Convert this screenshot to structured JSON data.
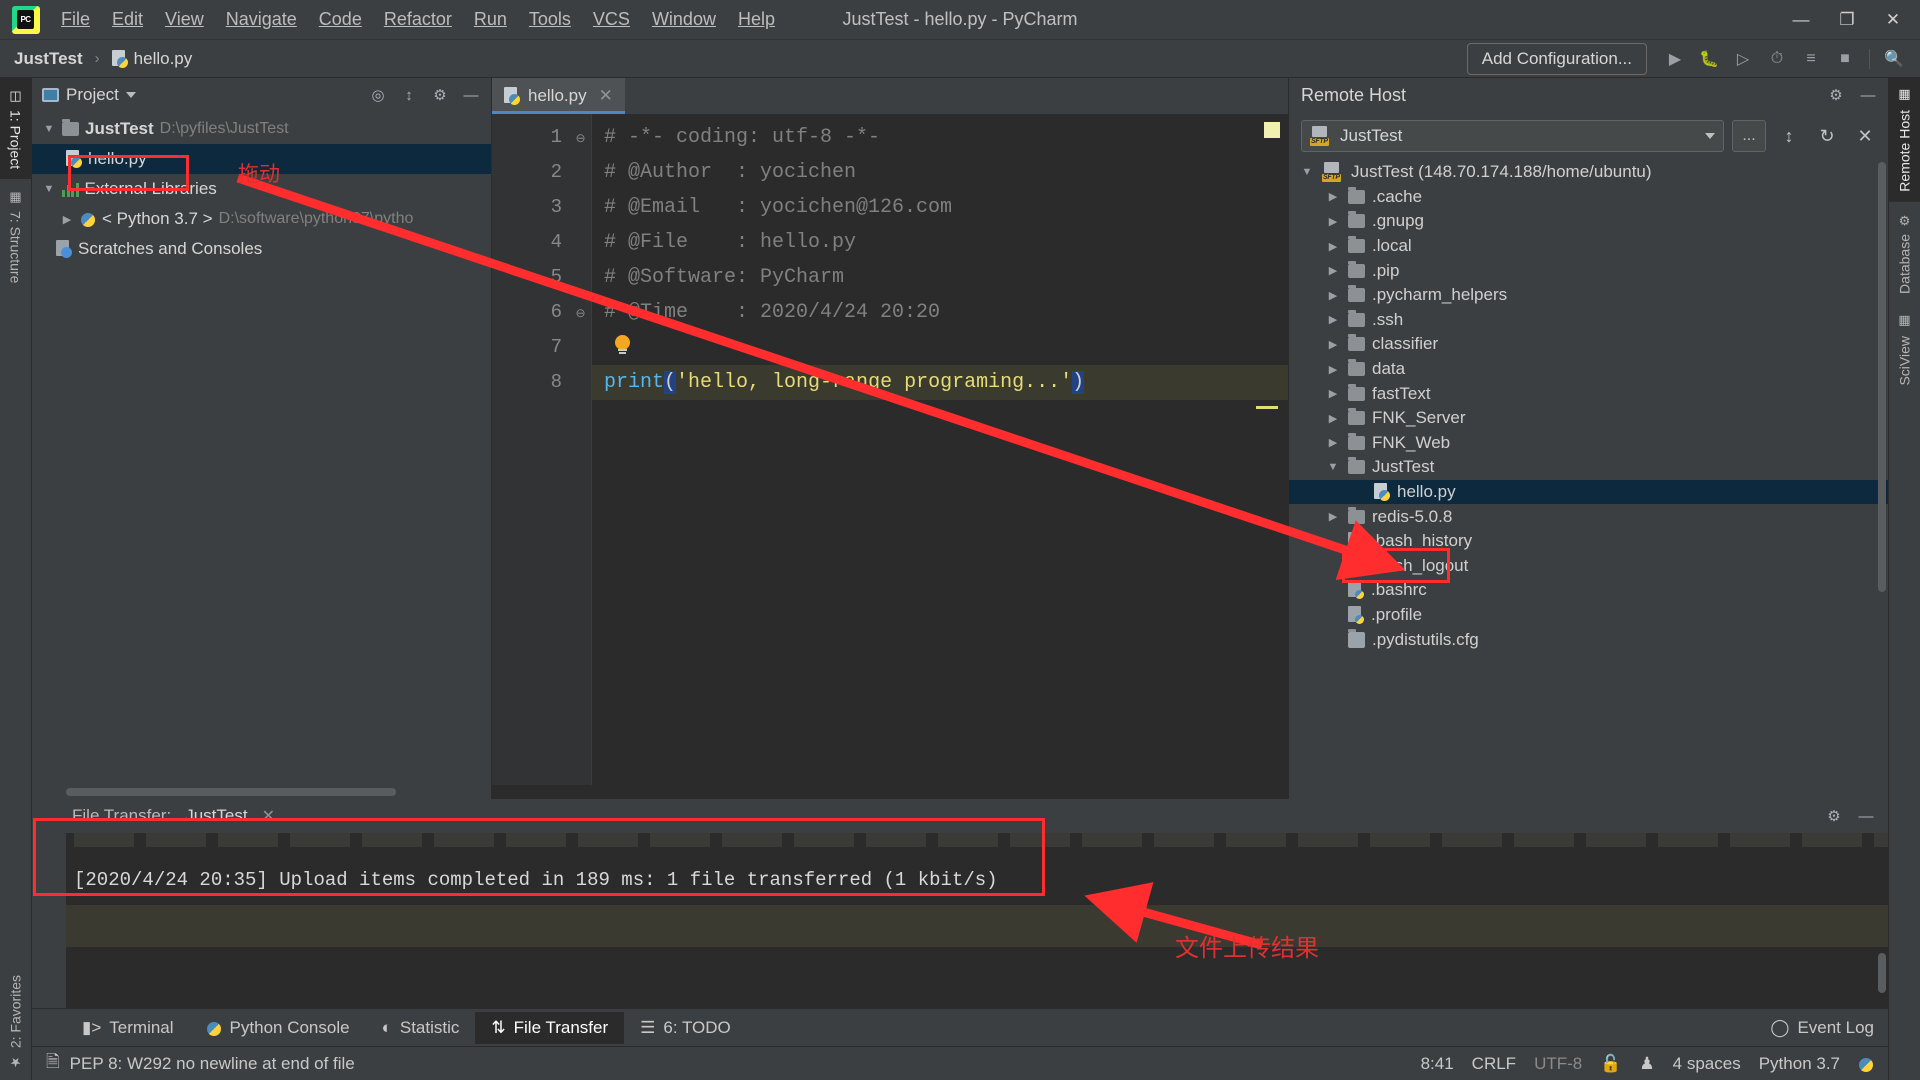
{
  "window": {
    "title": "JustTest - hello.py - PyCharm",
    "logo_label": "PC",
    "minimize": "—",
    "maximize": "❐",
    "close": "✕"
  },
  "menu": [
    {
      "label": "File"
    },
    {
      "label": "Edit"
    },
    {
      "label": "View"
    },
    {
      "label": "Navigate"
    },
    {
      "label": "Code"
    },
    {
      "label": "Refactor"
    },
    {
      "label": "Run"
    },
    {
      "label": "Tools"
    },
    {
      "label": "VCS"
    },
    {
      "label": "Window"
    },
    {
      "label": "Help"
    }
  ],
  "navbar": {
    "breadcrumb_project": "JustTest",
    "breadcrumb_sep": "›",
    "breadcrumb_file": "hello.py",
    "add_configuration": "Add Configuration...",
    "icons": [
      "run-icon",
      "debug-icon",
      "run-coverage-icon",
      "profile-icon",
      "run-with-console-icon",
      "stop-icon",
      "search-everywhere-icon"
    ]
  },
  "left_rail": [
    {
      "label": "1: Project",
      "selected": true,
      "icon": "project-icon"
    },
    {
      "label": "7: Structure",
      "selected": false,
      "icon": "structure-icon"
    },
    {
      "label": "2: Favorites",
      "selected": false,
      "icon": "star-icon"
    }
  ],
  "right_rail": [
    {
      "label": "Remote Host",
      "selected": true,
      "icon": "remote-host-icon"
    },
    {
      "label": "Database",
      "selected": false,
      "icon": "database-icon"
    },
    {
      "label": "SciView",
      "selected": false,
      "icon": "sciview-icon"
    }
  ],
  "project_panel": {
    "title": "Project",
    "head_icons": [
      "locate-icon",
      "collapse-all-icon",
      "gear-icon",
      "hide-icon"
    ],
    "tree": [
      {
        "arrow": "▼",
        "icon": "folder-icon",
        "label": "JustTest",
        "suffix": "D:\\pyfiles\\JustTest",
        "bold": true,
        "indent": 0,
        "selected": false
      },
      {
        "arrow": "",
        "icon": "python-file-icon",
        "label": "hello.py",
        "suffix": "",
        "bold": false,
        "indent": 1,
        "selected": true
      },
      {
        "arrow": "▼",
        "icon": "libraries-icon",
        "label": "External Libraries",
        "suffix": "",
        "bold": false,
        "indent": 0,
        "selected": false
      },
      {
        "arrow": "▶",
        "icon": "python-icon",
        "label": "< Python 3.7 >",
        "suffix": "D:\\software\\python37\\pytho",
        "bold": false,
        "indent": 1,
        "selected": false
      },
      {
        "arrow": "",
        "icon": "scratches-icon",
        "label": "Scratches and Consoles",
        "suffix": "",
        "bold": false,
        "indent": 0,
        "selected": false
      }
    ]
  },
  "editor": {
    "tab": {
      "label": "hello.py",
      "icon": "python-file-icon",
      "close": "✕"
    },
    "lines": [
      {
        "num": "1",
        "text": "# -*- coding: utf-8 -*-",
        "fold": "⊖"
      },
      {
        "num": "2",
        "text": "# @Author  : yocichen",
        "fold": ""
      },
      {
        "num": "3",
        "text": "# @Email   : yocichen@126.com",
        "fold": ""
      },
      {
        "num": "4",
        "text": "# @File    : hello.py",
        "fold": ""
      },
      {
        "num": "5",
        "text": "# @Software: PyCharm",
        "fold": ""
      },
      {
        "num": "6",
        "text": "# @Time    : 2020/4/24 20:20",
        "fold": "⊖"
      },
      {
        "num": "7",
        "text": "",
        "fold": ""
      },
      {
        "num": "8",
        "text": "print('hello, long-range programing...')",
        "fold": ""
      }
    ],
    "code_line_8": {
      "keyword": "print",
      "open_paren": "(",
      "string": "'hello, long-range programing...'",
      "close_paren": ")"
    }
  },
  "remote_panel": {
    "title": "Remote Host",
    "head_icons": [
      "gear-icon",
      "hide-icon"
    ],
    "selected_host": "JustTest",
    "host_icon": "sftp-icon",
    "browse_label": "...",
    "toolbar_icons": [
      "collapse-all-icon",
      "refresh-icon",
      "close-icon"
    ],
    "tree": [
      {
        "arrow": "▼",
        "icon": "sftp-icon",
        "label": "JustTest (148.70.174.188/home/ubuntu)",
        "indent": 0,
        "selected": false
      },
      {
        "arrow": "▶",
        "icon": "folder-icon",
        "label": ".cache",
        "indent": 1,
        "selected": false
      },
      {
        "arrow": "▶",
        "icon": "folder-icon",
        "label": ".gnupg",
        "indent": 1,
        "selected": false
      },
      {
        "arrow": "▶",
        "icon": "folder-icon",
        "label": ".local",
        "indent": 1,
        "selected": false
      },
      {
        "arrow": "▶",
        "icon": "folder-icon",
        "label": ".pip",
        "indent": 1,
        "selected": false
      },
      {
        "arrow": "▶",
        "icon": "folder-icon",
        "label": ".pycharm_helpers",
        "indent": 1,
        "selected": false
      },
      {
        "arrow": "▶",
        "icon": "folder-icon",
        "label": ".ssh",
        "indent": 1,
        "selected": false
      },
      {
        "arrow": "▶",
        "icon": "folder-icon",
        "label": "classifier",
        "indent": 1,
        "selected": false
      },
      {
        "arrow": "▶",
        "icon": "folder-icon",
        "label": "data",
        "indent": 1,
        "selected": false
      },
      {
        "arrow": "▶",
        "icon": "folder-icon",
        "label": "fastText",
        "indent": 1,
        "selected": false
      },
      {
        "arrow": "▶",
        "icon": "folder-icon",
        "label": "FNK_Server",
        "indent": 1,
        "selected": false
      },
      {
        "arrow": "▶",
        "icon": "folder-icon",
        "label": "FNK_Web",
        "indent": 1,
        "selected": false
      },
      {
        "arrow": "▼",
        "icon": "folder-icon",
        "label": "JustTest",
        "indent": 1,
        "selected": false
      },
      {
        "arrow": "",
        "icon": "python-file-icon",
        "label": "hello.py",
        "indent": 2,
        "selected": true
      },
      {
        "arrow": "▶",
        "icon": "folder-icon",
        "label": "redis-5.0.8",
        "indent": 1,
        "selected": false
      },
      {
        "arrow": "",
        "icon": "file-icon",
        "label": ".bash_history",
        "indent": 1,
        "selected": false
      },
      {
        "arrow": "",
        "icon": "file-icon",
        "label": ".bash_logout",
        "indent": 1,
        "selected": false
      },
      {
        "arrow": "",
        "icon": "file-icon",
        "label": ".bashrc",
        "indent": 1,
        "selected": false
      },
      {
        "arrow": "",
        "icon": "file-icon",
        "label": ".profile",
        "indent": 1,
        "selected": false
      },
      {
        "arrow": "",
        "icon": "cfg-file-icon",
        "label": ".pydistutils.cfg",
        "indent": 1,
        "selected": false
      }
    ]
  },
  "file_transfer": {
    "label": "File Transfer:",
    "session": "JustTest",
    "close": "✕",
    "head_icons": [
      "gear-icon",
      "hide-icon"
    ],
    "log_line": "[2020/4/24 20:35] Upload items completed in 189 ms: 1 file transferred (1 kbit/s)"
  },
  "tool_window_bar": {
    "buttons": [
      {
        "label": "Terminal",
        "icon": "terminal-icon",
        "active": false
      },
      {
        "label": "Python Console",
        "icon": "python-icon",
        "active": false
      },
      {
        "label": "Statistic",
        "icon": "pie-chart-icon",
        "active": false
      },
      {
        "label": "File Transfer",
        "icon": "transfer-icon",
        "active": true
      },
      {
        "label": "6: TODO",
        "icon": "list-icon",
        "active": false
      }
    ],
    "event_log": "Event Log",
    "event_log_icon": "balloon-icon"
  },
  "status_bar": {
    "inspection_icon": "document-icon",
    "message": "PEP 8: W292 no newline at end of file",
    "caret": "8:41",
    "line_separator": "CRLF",
    "encoding": "UTF-8",
    "lock_icon": "unlock-icon",
    "hat_icon": "hector-icon",
    "indent": "4 spaces",
    "interpreter": "Python 3.7",
    "gear_icon": "python-settings-icon"
  },
  "annotations": {
    "drag_label": "拖动",
    "upload_result_label": "文件上传结果",
    "accent_color": "#ff2d2d"
  }
}
